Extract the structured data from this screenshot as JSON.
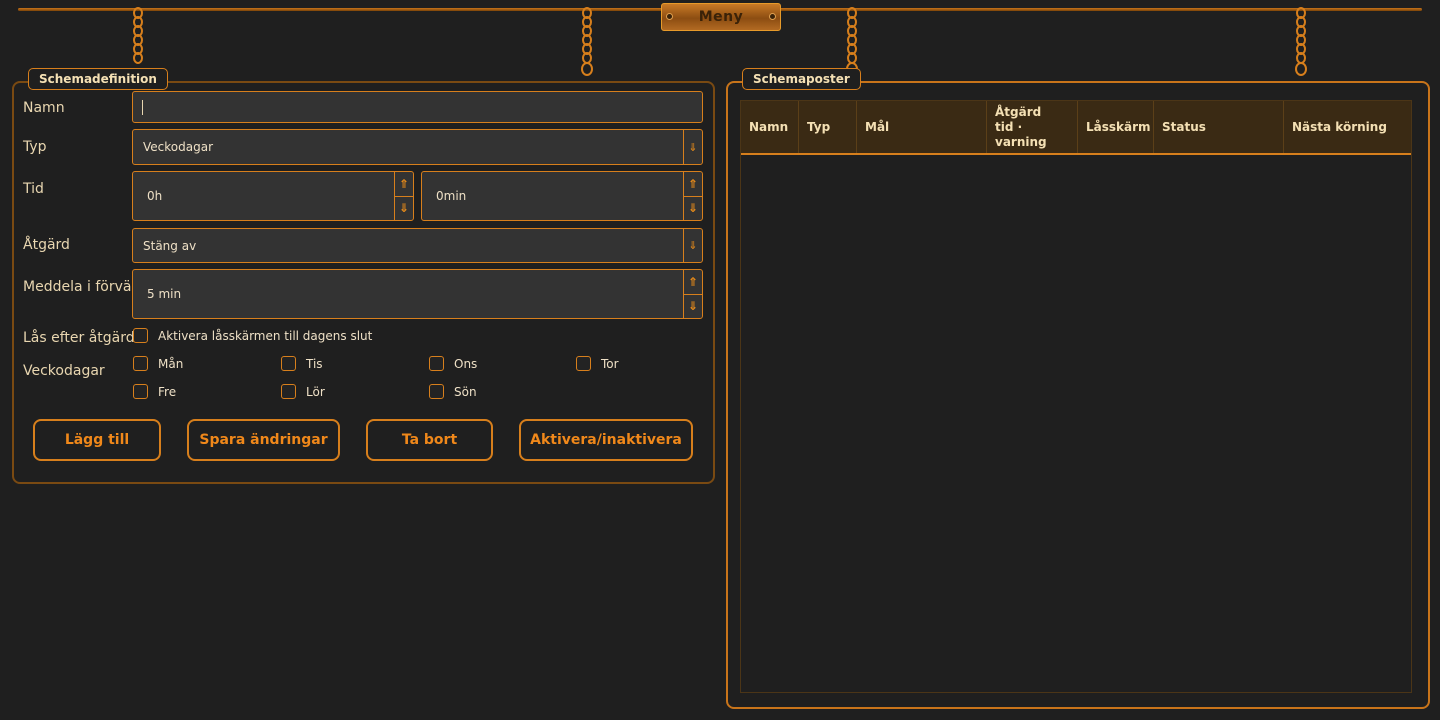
{
  "menu": {
    "label": "Meny"
  },
  "definition": {
    "legend": "Schemadefinition",
    "name_label": "Namn",
    "name_value": "",
    "type_label": "Typ",
    "type_value": "Veckodagar",
    "time_label": "Tid",
    "hours_value": "0h",
    "minutes_value": "0min",
    "action_label": "Åtgärd",
    "action_value": "Stäng av",
    "notify_label": "Meddela i förväg",
    "notify_value": "5 min",
    "lock_label": "Lås efter åtgärd",
    "lock_checkbox_label": "Aktivera låsskärmen till dagens slut",
    "lock_checked": false,
    "weekdays_label": "Veckodagar",
    "weekdays": [
      {
        "label": "Mån",
        "checked": false
      },
      {
        "label": "Tis",
        "checked": false
      },
      {
        "label": "Ons",
        "checked": false
      },
      {
        "label": "Tor",
        "checked": false
      },
      {
        "label": "Fre",
        "checked": false
      },
      {
        "label": "Lör",
        "checked": false
      },
      {
        "label": "Sön",
        "checked": false
      }
    ],
    "buttons": {
      "add": "Lägg till",
      "save": "Spara ändringar",
      "delete": "Ta bort",
      "toggle": "Aktivera/inaktivera"
    }
  },
  "entries": {
    "legend": "Schemaposter",
    "columns": [
      {
        "line1": "Namn",
        "line2": ""
      },
      {
        "line1": "Typ",
        "line2": ""
      },
      {
        "line1": "Mål",
        "line2": ""
      },
      {
        "line1": "Åtgärd",
        "line2": "tid · varning"
      },
      {
        "line1": "Låsskärm",
        "line2": ""
      },
      {
        "line1": "Status",
        "line2": ""
      },
      {
        "line1": "Nästa körning",
        "line2": ""
      }
    ],
    "rows": []
  },
  "icons": {
    "combo_arrow": "arrow-down-icon",
    "spin_up": "arrow-up-icon",
    "spin_down": "arrow-down-icon",
    "chain": "chain-icon"
  },
  "colors": {
    "accent": "#d77f1c",
    "background": "#1f1f1f",
    "text": "#e8d6b0"
  }
}
